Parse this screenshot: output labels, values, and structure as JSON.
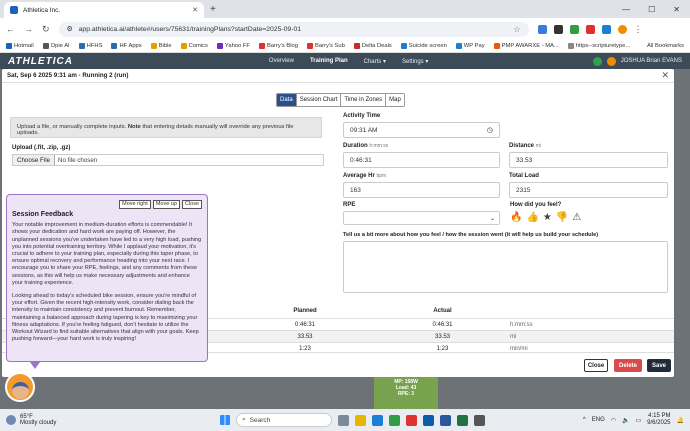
{
  "browser": {
    "tab_title": "Athletica Inc.",
    "new_tab": "+",
    "url": "app.athletica.ai/athlete#/users/75631/trainingPlans?startDate=2025-09-01",
    "bookmarks": [
      "Hotmail",
      "Opie AI",
      "HFHS",
      "HF Apps",
      "Bible",
      "Comics",
      "Yahoo FF",
      "Barry's Blog",
      "Barry's Sub",
      "Delta Deals",
      "Suicide screen",
      "WP Pay",
      "PMP AWARXE - MA...",
      "https--scripturetype..."
    ],
    "all_bookmarks": "All Bookmarks"
  },
  "appnav": {
    "logo": "ATHLETICA",
    "links": [
      "Overview",
      "Training Plan",
      "Charts ▾",
      "Settings ▾"
    ],
    "user": "JOSHUA Brian EVANS"
  },
  "modal": {
    "title": "Sat, Sep 6 2025 9:31 am - Running 2 (run)",
    "tabs": [
      "Data",
      "Session Chart",
      "Time in Zones",
      "Map"
    ],
    "upload_note_prefix": "Upload a file, or manually complete inputs. ",
    "upload_note_bold": "Note",
    "upload_note_suffix": " that entering details manually will override any previous file uploads.",
    "upload_label": "Upload (.fit, .zip, .gz)",
    "choose_file": "Choose File",
    "no_file": "No file chosen",
    "activity_time_label": "Activity Time",
    "activity_time": "09:31 AM",
    "duration_label": "Duration",
    "duration_unit": "h:mm:ss",
    "duration": "0:46:31",
    "distance_label": "Distance",
    "distance_unit": "mi",
    "distance": "33.53",
    "avg_hr_label": "Average Hr",
    "avg_hr_unit": "bpm",
    "avg_hr": "163",
    "total_load_label": "Total Load",
    "total_load": "2315",
    "rpe_label": "RPE",
    "feel_label": "How did you feel?",
    "tell_label": "Tell us a bit more about how you feel / how the session went (it will help us build your schedule)",
    "table": {
      "headers": [
        "",
        "Planned",
        "Actual",
        ""
      ],
      "rows": [
        [
          "",
          "0:46:31",
          "0:46:31",
          "h:mm:ss"
        ],
        [
          "",
          "33.53",
          "33.53",
          "mi"
        ],
        [
          "",
          "1:23",
          "1:23",
          "min/mi"
        ]
      ]
    },
    "footer": {
      "close": "Close",
      "delete": "Delete",
      "save": "Save"
    }
  },
  "feedback": {
    "move_right": "Move right",
    "move_up": "Move up",
    "close": "Close",
    "title": "Session Feedback",
    "p1": "Your notable improvement in medium-duration efforts is commendable! It shows your dedication and hard work are paying off. However, the unplanned sessions you've undertaken have led to a very high load, pushing you into potential overtraining territory. While I applaud your motivation, it's crucial to adhere to your training plan, especially during this taper phase, to ensure optimal recovery and performance heading into your next race. I encourage you to share your RPE, feelings, and any comments from these sessions, as this will help us make necessary adjustments and enhance your training experience.",
    "p2": "Looking ahead to today's scheduled bike session, ensure you're mindful of your effort. Given the recent high-intensity work, consider dialing back the intensity to maintain consistency and prevent burnout. Remember, maintaining a balanced approach during tapering is key to maximizing your fitness adaptations. If you're feeling fatigued, don't hesitate to utilize the Workout Wizard to find suitable alternatives that align with your goals. Keep pushing forward—your hard work is truly inspiring!"
  },
  "greenbox": {
    "l1": "MP: 158W",
    "l2": "Load: 43",
    "l3": "RPE: 3"
  },
  "taskbar": {
    "temp": "65°F",
    "weather": "Mostly cloudy",
    "search": "Search",
    "lang": "ENG",
    "time": "4:15 PM",
    "date": "9/6/2025"
  }
}
